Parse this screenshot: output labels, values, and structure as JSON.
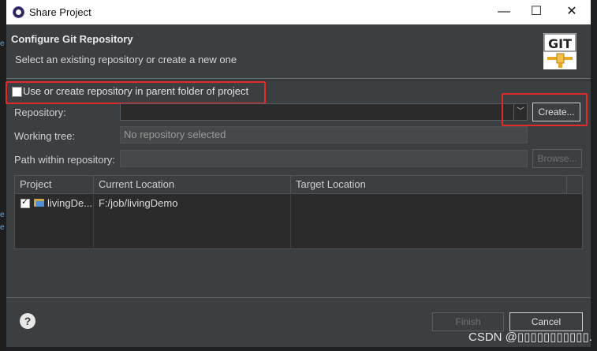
{
  "window": {
    "title": "Share Project"
  },
  "title_buttons": {
    "minimize": "—",
    "maximize": "☐",
    "close": "✕"
  },
  "header": {
    "title": "Configure Git Repository",
    "subtitle": "Select an existing repository or create a new one",
    "logo_text": "GIT"
  },
  "checkbox": {
    "label": "Use or create repository in parent folder of project",
    "checked": false
  },
  "repository": {
    "label": "Repository:",
    "value": "",
    "create_label": "Create..."
  },
  "working_tree": {
    "label": "Working tree:",
    "value": "No repository selected"
  },
  "path_within": {
    "label": "Path within repository:",
    "value": "",
    "browse_label": "Browse..."
  },
  "table": {
    "columns": [
      "Project",
      "Current Location",
      "Target Location"
    ],
    "rows": [
      {
        "checked": true,
        "project": "livingDe...",
        "current": "F:/job/livingDemo",
        "target": ""
      }
    ]
  },
  "footer": {
    "help": "?",
    "finish_label": "Finish",
    "cancel_label": "Cancel"
  },
  "watermark": "CSDN @▯▯▯▯▯▯▯▯▯▯▯.",
  "colors": {
    "highlight": "#e12b2b",
    "background": "#3c3f41",
    "titlebar": "#ffffff"
  },
  "left_strip": [
    "e",
    "e",
    "e"
  ]
}
